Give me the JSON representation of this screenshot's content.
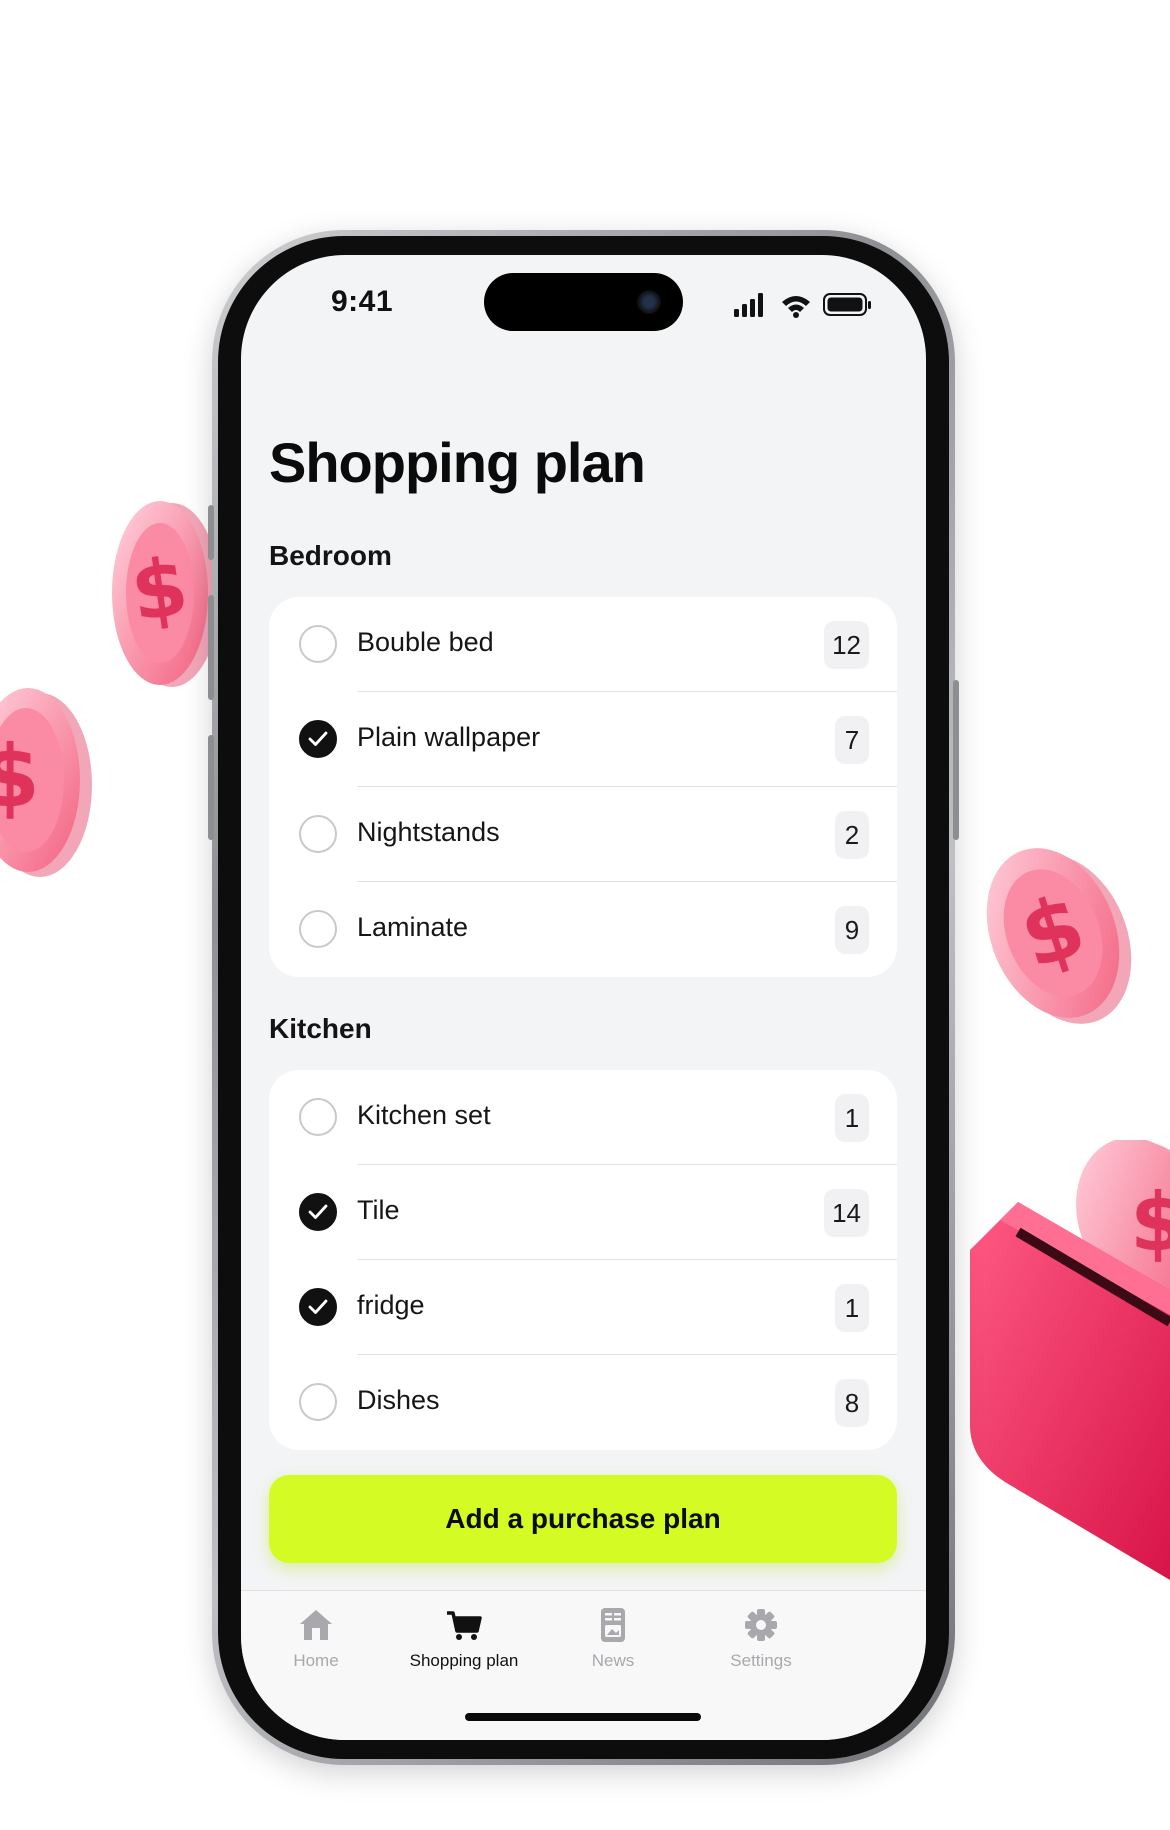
{
  "status_bar": {
    "time": "9:41"
  },
  "page": {
    "title": "Shopping plan"
  },
  "sections": [
    {
      "title": "Bedroom",
      "items": [
        {
          "label": "Bouble bed",
          "qty": "12",
          "checked": false
        },
        {
          "label": "Plain wallpaper",
          "qty": "7",
          "checked": true
        },
        {
          "label": "Nightstands",
          "qty": "2",
          "checked": false
        },
        {
          "label": "Laminate",
          "qty": "9",
          "checked": false
        }
      ]
    },
    {
      "title": "Kitchen",
      "items": [
        {
          "label": "Kitchen set",
          "qty": "1",
          "checked": false
        },
        {
          "label": "Tile",
          "qty": "14",
          "checked": true
        },
        {
          "label": "fridge",
          "qty": "1",
          "checked": true
        },
        {
          "label": "Dishes",
          "qty": "8",
          "checked": false
        }
      ]
    }
  ],
  "add_button": {
    "label": "Add a purchase plan"
  },
  "tabbar": {
    "tabs": [
      {
        "label": "Home",
        "icon": "home-icon",
        "active": false
      },
      {
        "label": "Shopping plan",
        "icon": "cart-icon",
        "active": true
      },
      {
        "label": "News",
        "icon": "news-icon",
        "active": false
      },
      {
        "label": "Settings",
        "icon": "gear-icon",
        "active": false
      }
    ]
  },
  "colors": {
    "accent": "#d4fc24",
    "screen_background": "#f3f4f6",
    "coin_pink": "#f9799a",
    "wallet_red": "#e8245a"
  }
}
